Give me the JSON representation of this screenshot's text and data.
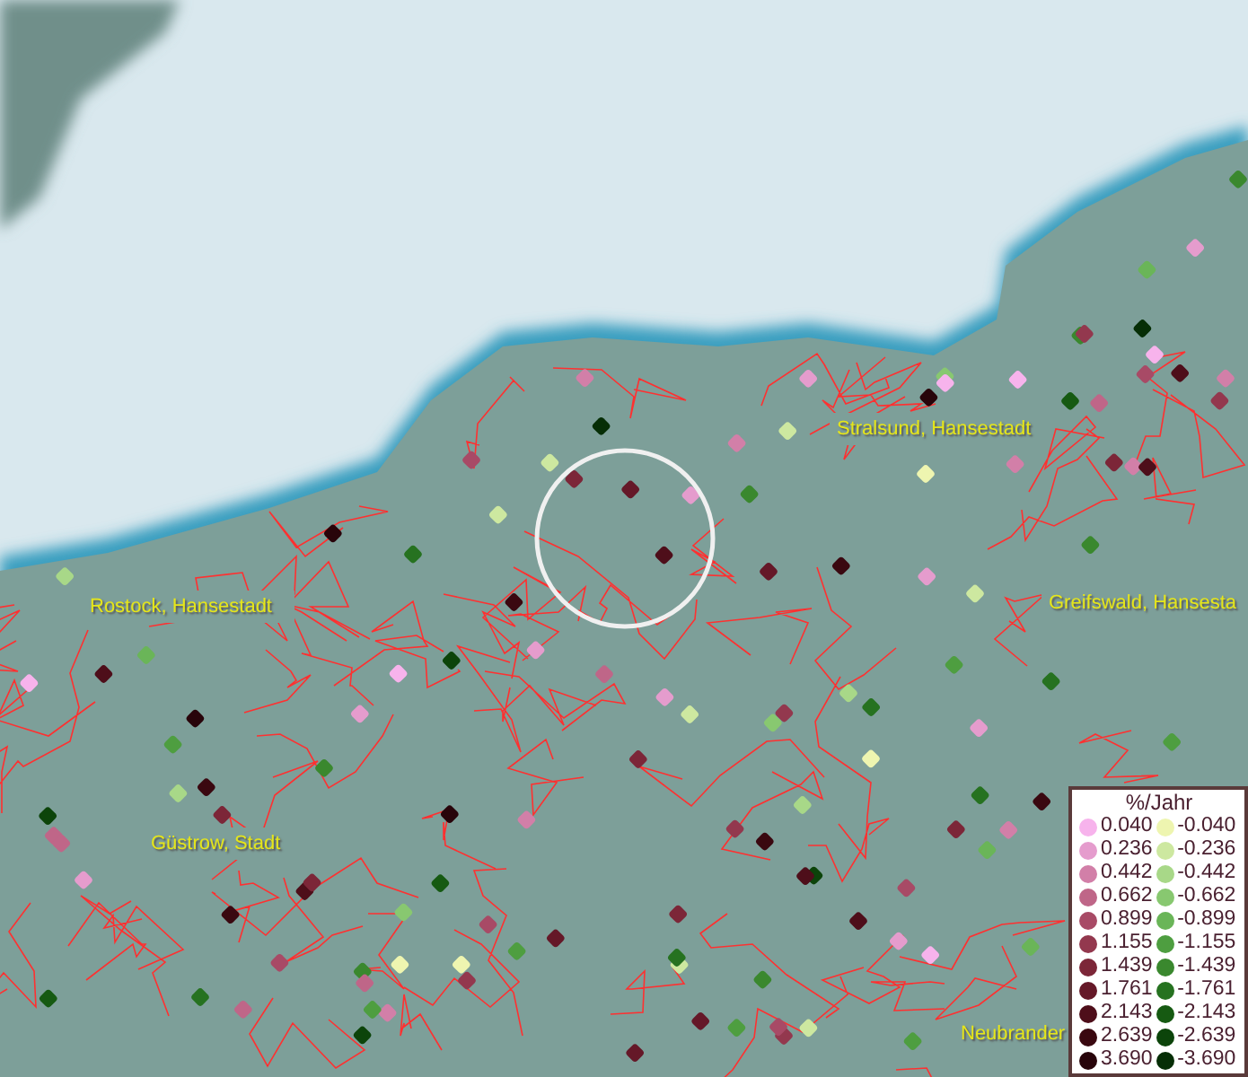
{
  "map": {
    "places": [
      {
        "name": "Stralsund, Hansestadt"
      },
      {
        "name": "Rostock, Hansestadt"
      },
      {
        "name": "Greifswald, Hansesta"
      },
      {
        "name": "Güstrow, Stadt"
      },
      {
        "name": "Neubrander"
      }
    ]
  },
  "legend": {
    "title": "%/Jahr",
    "positive": [
      {
        "label": "0.040",
        "color": "#f7b3ec"
      },
      {
        "label": "0.236",
        "color": "#e59ccd"
      },
      {
        "label": "0.442",
        "color": "#d27fa8"
      },
      {
        "label": "0.662",
        "color": "#bf6688"
      },
      {
        "label": "0.899",
        "color": "#a84a66"
      },
      {
        "label": "1.155",
        "color": "#93384e"
      },
      {
        "label": "1.439",
        "color": "#7c2638"
      },
      {
        "label": "1.761",
        "color": "#651828"
      },
      {
        "label": "2.143",
        "color": "#4e0e1a"
      },
      {
        "label": "2.639",
        "color": "#3a0810"
      },
      {
        "label": "3.690",
        "color": "#28040a"
      }
    ],
    "negative": [
      {
        "label": "-0.040",
        "color": "#eef5b0"
      },
      {
        "label": "-0.236",
        "color": "#cde8a0"
      },
      {
        "label": "-0.442",
        "color": "#a8d888"
      },
      {
        "label": "-0.662",
        "color": "#88c870"
      },
      {
        "label": "-0.899",
        "color": "#6ab558"
      },
      {
        "label": "-1.155",
        "color": "#4e9e40"
      },
      {
        "label": "-1.439",
        "color": "#3a882e"
      },
      {
        "label": "-1.761",
        "color": "#267220"
      },
      {
        "label": "-2.143",
        "color": "#165a12"
      },
      {
        "label": "-2.639",
        "color": "#0c440a"
      },
      {
        "label": "-3.690",
        "color": "#062e06"
      }
    ]
  }
}
